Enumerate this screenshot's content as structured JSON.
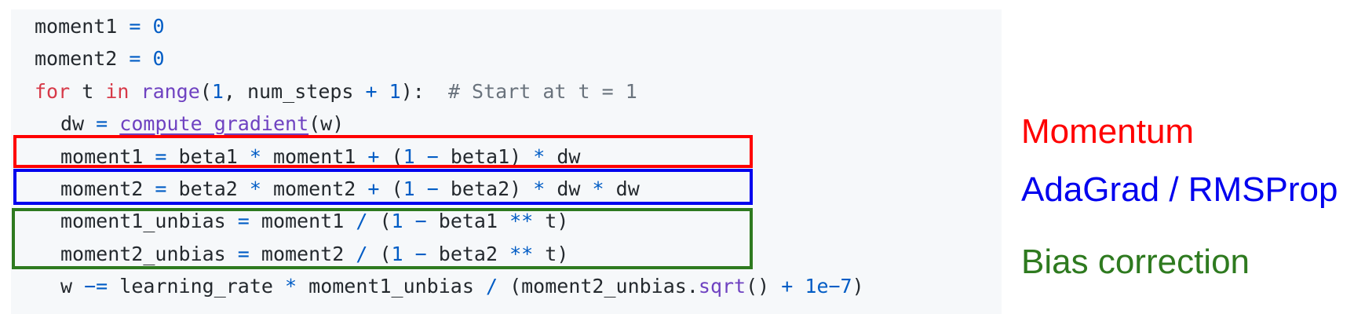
{
  "colors": {
    "momentum": "#ff0000",
    "adagrad": "#0000ee",
    "bias": "#2e7a1f",
    "code_bg": "#f6f8fa"
  },
  "code": {
    "l1": {
      "a": "moment1",
      "eq": "=",
      "v": "0"
    },
    "l2": {
      "a": "moment2",
      "eq": "=",
      "v": "0"
    },
    "l3": {
      "for": "for",
      "t": "t",
      "in": "in",
      "range": "range",
      "p1": "(",
      "one": "1",
      "comma": ", num_steps",
      "plus": "+",
      "one2": "1",
      "p2": "):",
      "comment": "# Start at t = 1"
    },
    "l4": {
      "a": "dw",
      "eq": "=",
      "fn": "compute_gradient",
      "args": "(w)"
    },
    "l5": {
      "a": "moment1",
      "eq": "=",
      "b": "beta1",
      "mul": "*",
      "c": "moment1",
      "plus": "+",
      "p": "(",
      "one": "1",
      "minus": "−",
      "d": "beta1)",
      "mul2": "*",
      "e": "dw"
    },
    "l6": {
      "a": "moment2",
      "eq": "=",
      "b": "beta2",
      "mul": "*",
      "c": "moment2",
      "plus": "+",
      "p": "(",
      "one": "1",
      "minus": "−",
      "d": "beta2)",
      "mul2": "*",
      "e": "dw",
      "mul3": "*",
      "f": "dw"
    },
    "l7": {
      "a": "moment1_unbias",
      "eq": "=",
      "b": "moment1",
      "div": "/",
      "p": "(",
      "one": "1",
      "minus": "−",
      "c": "beta1",
      "pow": "**",
      "d": "t)"
    },
    "l8": {
      "a": "moment2_unbias",
      "eq": "=",
      "b": "moment2",
      "div": "/",
      "p": "(",
      "one": "1",
      "minus": "−",
      "c": "beta2",
      "pow": "**",
      "d": "t)"
    },
    "l9": {
      "a": "w",
      "op": "−=",
      "b": "learning_rate",
      "mul": "*",
      "c": "moment1_unbias",
      "div": "/",
      "d": "(moment2_unbias.",
      "fn": "sqrt",
      "e": "()",
      "plus": "+",
      "num": "1e−7",
      "f": ")"
    }
  },
  "annotations": {
    "momentum": "Momentum",
    "adagrad": "AdaGrad / RMSProp",
    "bias": "Bias correction"
  }
}
